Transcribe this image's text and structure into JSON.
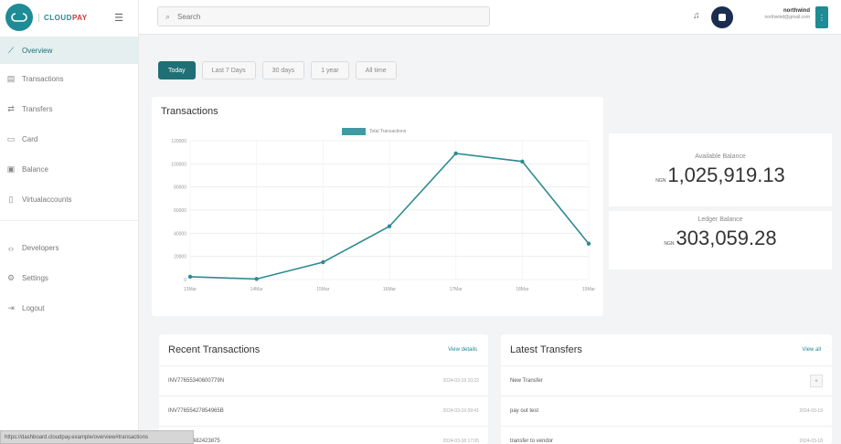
{
  "brand": {
    "part1": "CLOUD",
    "part2": "PAY"
  },
  "sidebar": {
    "items": [
      {
        "label": "Overview",
        "icon": "chart-line-icon",
        "glyph": "⟋"
      },
      {
        "label": "Transactions",
        "icon": "receipt-icon",
        "glyph": "▤"
      },
      {
        "label": "Transfers",
        "icon": "transfer-icon",
        "glyph": "⇄"
      },
      {
        "label": "Card",
        "icon": "card-icon",
        "glyph": "▭"
      },
      {
        "label": "Balance",
        "icon": "wallet-icon",
        "glyph": "▣"
      },
      {
        "label": "Virtualaccounts",
        "icon": "document-icon",
        "glyph": "▯"
      }
    ],
    "secondary": [
      {
        "label": "Developers",
        "icon": "code-icon",
        "glyph": "‹›"
      },
      {
        "label": "Settings",
        "icon": "gear-icon",
        "glyph": "⚙"
      },
      {
        "label": "Logout",
        "icon": "logout-icon",
        "glyph": "⇥"
      }
    ]
  },
  "topbar": {
    "search_placeholder": "Search",
    "user_name": "northwind",
    "user_email": "northwind@gmail.com"
  },
  "filters": [
    "Today",
    "Last 7 Days",
    "30 days",
    "1 year",
    "All time"
  ],
  "chart_card": {
    "title": "Transactions"
  },
  "chart_data": {
    "type": "line",
    "title": "Transactions",
    "legend": "Total Transactions",
    "categories": [
      "13Mar",
      "14Mar",
      "15Mar",
      "16Mar",
      "17Mar",
      "18Mar",
      "19Mar"
    ],
    "values": [
      2400,
      500,
      15000,
      46000,
      109000,
      102000,
      31000
    ],
    "yticks": [
      "0",
      "20000",
      "40000",
      "60000",
      "80000",
      "100000",
      "120000"
    ],
    "ylim": [
      0,
      120000
    ],
    "color": "#2e8b92",
    "grid": true,
    "legend_position": "top-center"
  },
  "balances": {
    "available_label": "Available Balance",
    "available_currency": "NGN",
    "available_amount": "1,025,919.13",
    "ledger_label": "Ledger Balance",
    "ledger_currency": "NGN",
    "ledger_amount": "303,059.28"
  },
  "recent": {
    "title": "Recent Transactions",
    "link": "View details",
    "rows": [
      {
        "ref": "INV77655340600779N",
        "time": "2024-03-19 10:22"
      },
      {
        "ref": "INV77655427854965B",
        "time": "2024-03-19 09:41"
      },
      {
        "ref": "INV77655482423875",
        "time": "2024-03-18 17:05"
      }
    ]
  },
  "transfers": {
    "title": "Latest Transfers",
    "link": "View all",
    "rows": [
      {
        "ref": "New Transfer",
        "time": ""
      },
      {
        "ref": "pay out test",
        "time": "2024-03-19"
      },
      {
        "ref": "transfer to vendor",
        "time": "2024-03-18"
      }
    ]
  },
  "statusbar": "https://dashboard.cloudpay.example/overview#transactions"
}
